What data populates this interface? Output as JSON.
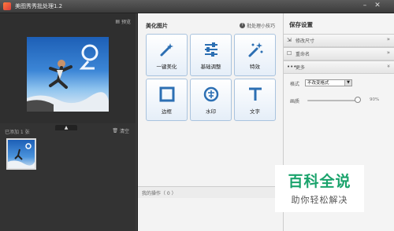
{
  "window": {
    "title": "美图秀秀批处理1.2"
  },
  "left_panel": {
    "preview_label": "预览",
    "added_label": "已添加 1 张",
    "clear_label": "清空"
  },
  "middle_panel": {
    "title": "美化图片",
    "help_label": "批处理小技巧",
    "tools": [
      {
        "label": "一键美化",
        "icon": "magic-wand-icon"
      },
      {
        "label": "基础调整",
        "icon": "sliders-icon"
      },
      {
        "label": "特效",
        "icon": "sparkle-wand-icon"
      },
      {
        "label": "边框",
        "icon": "frame-icon"
      },
      {
        "label": "水印",
        "icon": "watermark-stamp-icon"
      },
      {
        "label": "文字",
        "icon": "text-t-icon"
      }
    ],
    "operations_label": "我的操作（ 0 ）"
  },
  "right_panel": {
    "title": "保存设置",
    "sections": [
      {
        "label": "修改尺寸",
        "icon": "resize-icon",
        "chevron": "»"
      },
      {
        "label": "重命名",
        "icon": "rename-icon",
        "chevron": "»"
      },
      {
        "label": "更多",
        "icon": "more-icon",
        "chevron": "»"
      }
    ],
    "format_label": "格式",
    "format_value": "不改变格式",
    "quality_label": "画质",
    "quality_value": "90%",
    "quality_fraction": 0.9
  },
  "watermark": {
    "brand": "百科全说",
    "slogan": "助你轻松解决"
  },
  "colors": {
    "accent_green": "#1aa36c",
    "tool_blue": "#2c6fb3"
  }
}
